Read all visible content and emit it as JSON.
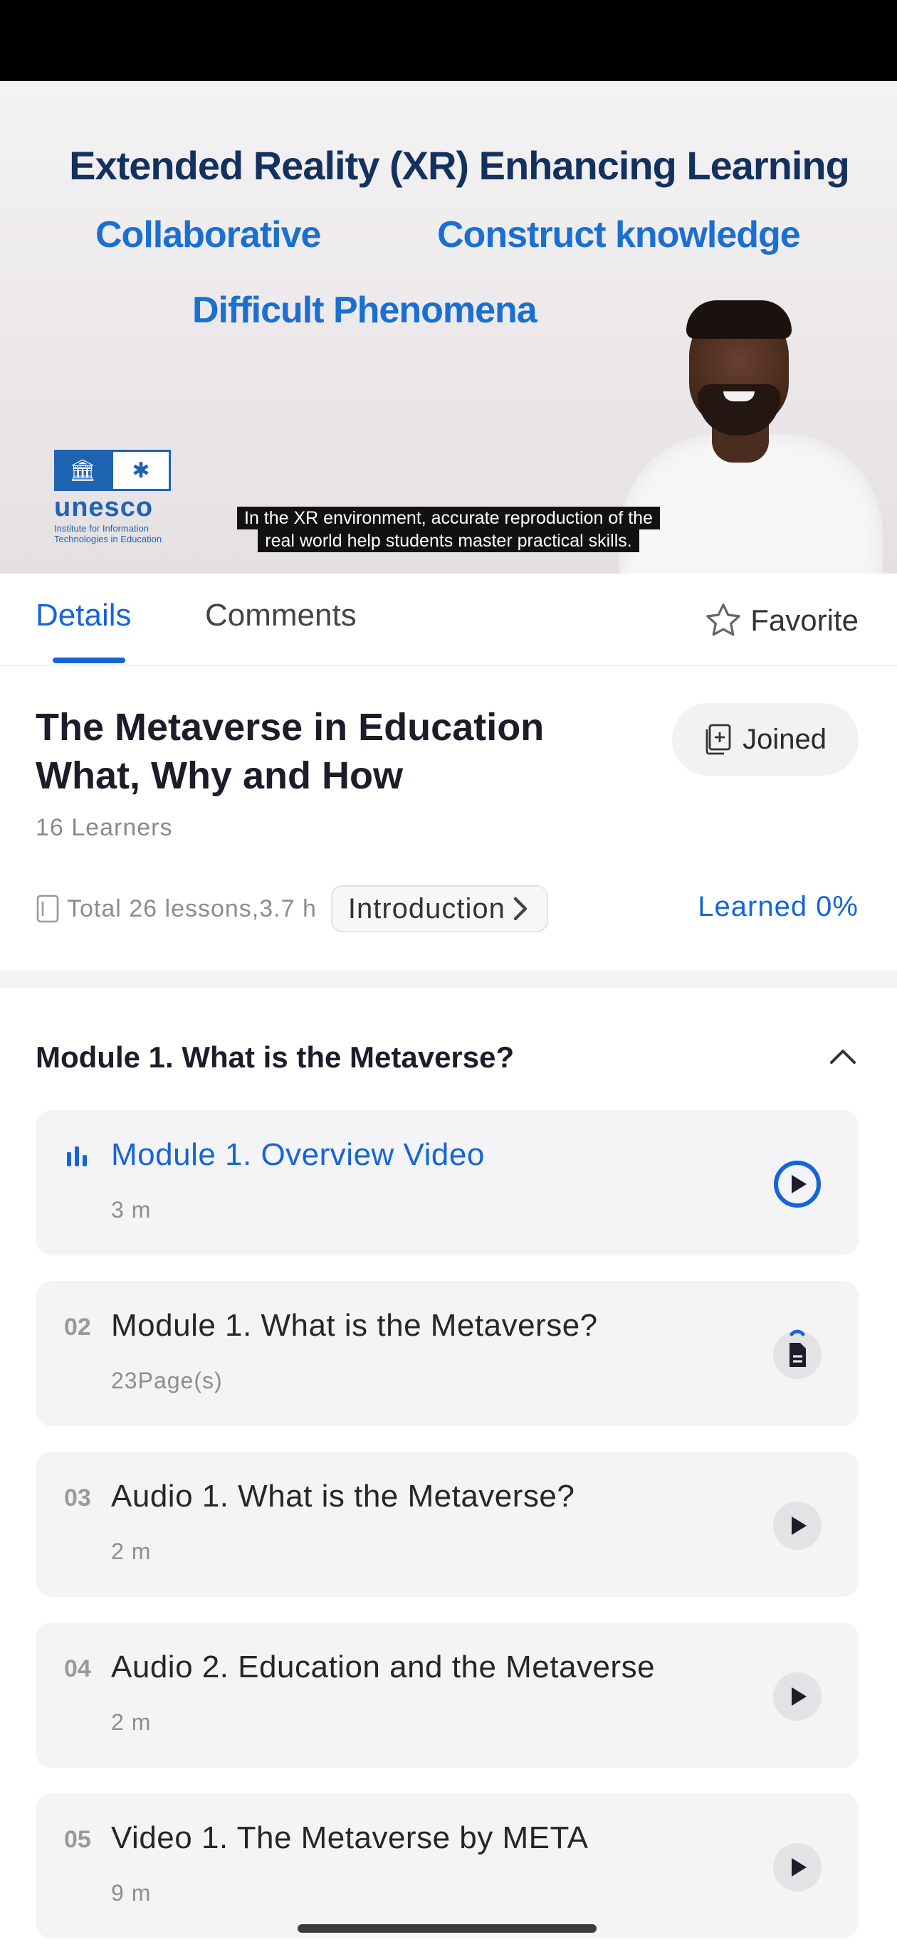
{
  "video": {
    "slide_title": "Extended Reality (XR) Enhancing Learning",
    "keywords": [
      "Collaborative",
      "Construct knowledge",
      "Difficult Phenomena"
    ],
    "logo_name": "unesco",
    "logo_subtitle": "Institute for Information Technologies in Education",
    "caption_line1": "In the XR environment, accurate reproduction of the",
    "caption_line2": "real world help students master practical skills."
  },
  "tabs": {
    "details": "Details",
    "comments": "Comments",
    "active": "Details"
  },
  "favorite": {
    "label": "Favorite",
    "icon": "star-outline-icon"
  },
  "course": {
    "title": "The Metaverse in Education What, Why and How",
    "joined_label": "Joined",
    "learners": "16 Learners",
    "total_lessons": "Total 26 lessons,3.7 h",
    "introduction_label": "Introduction",
    "learned": "Learned 0%"
  },
  "module": {
    "title": "Module 1. What is the Metaverse?",
    "expanded": true,
    "lessons": [
      {
        "num": "",
        "title": "Module 1. Overview Video",
        "meta": "3 m",
        "type": "video",
        "playing": true
      },
      {
        "num": "02",
        "title": "Module 1. What is the Metaverse?",
        "meta": "23Page(s)",
        "type": "document",
        "playing": false
      },
      {
        "num": "03",
        "title": "Audio 1. What is the Metaverse?",
        "meta": "2 m",
        "type": "audio",
        "playing": false
      },
      {
        "num": "04",
        "title": "Audio 2. Education and the Metaverse",
        "meta": "2 m",
        "type": "audio",
        "playing": false
      },
      {
        "num": "05",
        "title": "Video 1. The Metaverse by META",
        "meta": "9 m",
        "type": "video",
        "playing": false
      }
    ]
  },
  "colors": {
    "accent": "#1565d8",
    "card_bg": "#f4f4f6",
    "slide_heading": "#13315f",
    "slide_keyword": "#1a6fd1"
  }
}
